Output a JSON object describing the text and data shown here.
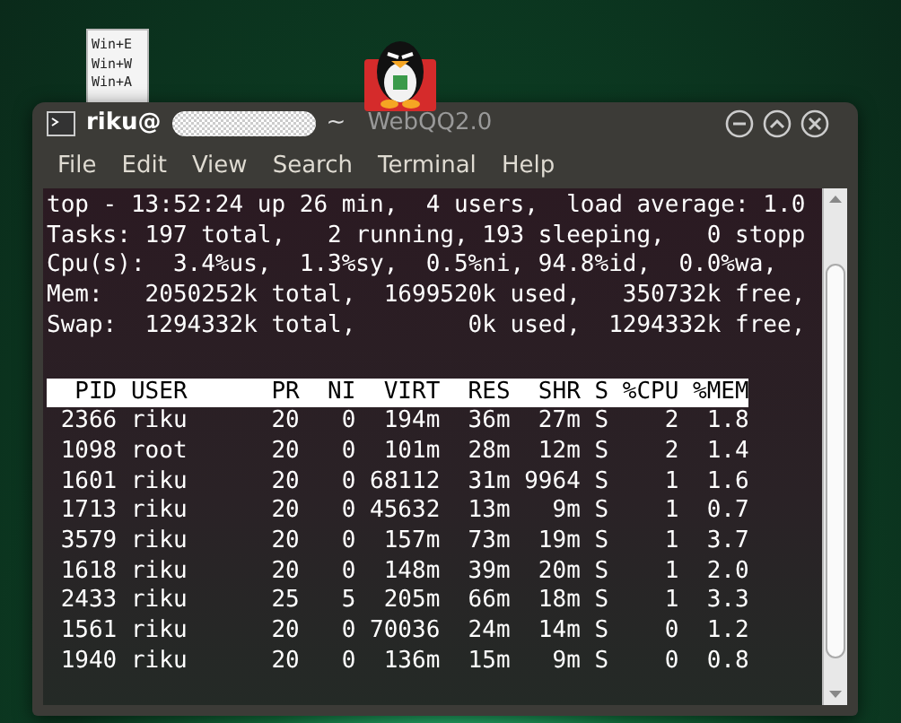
{
  "desktop": {
    "icons": [
      {
        "kind": "document",
        "lines": [
          "Win+E",
          "Win+W",
          "Win+A"
        ]
      },
      {
        "kind": "penguin",
        "label": "WebQQ2.0"
      }
    ]
  },
  "window": {
    "title": "riku@",
    "title_suffix": "~"
  },
  "menu": [
    "File",
    "Edit",
    "View",
    "Search",
    "Terminal",
    "Help"
  ],
  "terminal": {
    "summary": [
      "top - 13:52:24 up 26 min,  4 users,  load average: 1.0",
      "Tasks: 197 total,   2 running, 193 sleeping,   0 stopp",
      "Cpu(s):  3.4%us,  1.3%sy,  0.5%ni, 94.8%id,  0.0%wa,",
      "Mem:   2050252k total,  1699520k used,   350732k free,",
      "Swap:  1294332k total,        0k used,  1294332k free,"
    ],
    "header": "  PID USER      PR  NI  VIRT  RES  SHR S %CPU %MEM",
    "processes": [
      " 2366 riku      20   0  194m  36m  27m S    2  1.8",
      " 1098 root      20   0  101m  28m  12m S    2  1.4",
      " 1601 riku      20   0 68112  31m 9964 S    1  1.6",
      " 1713 riku      20   0 45632  13m   9m S    1  0.7",
      " 3579 riku      20   0  157m  73m  19m S    1  3.7",
      " 1618 riku      20   0  148m  39m  20m S    1  2.0",
      " 2433 riku      25   5  205m  66m  18m S    1  3.3",
      " 1561 riku      20   0 70036  24m  14m S    0  1.2",
      " 1940 riku      20   0  136m  15m   9m S    0  0.8"
    ]
  }
}
